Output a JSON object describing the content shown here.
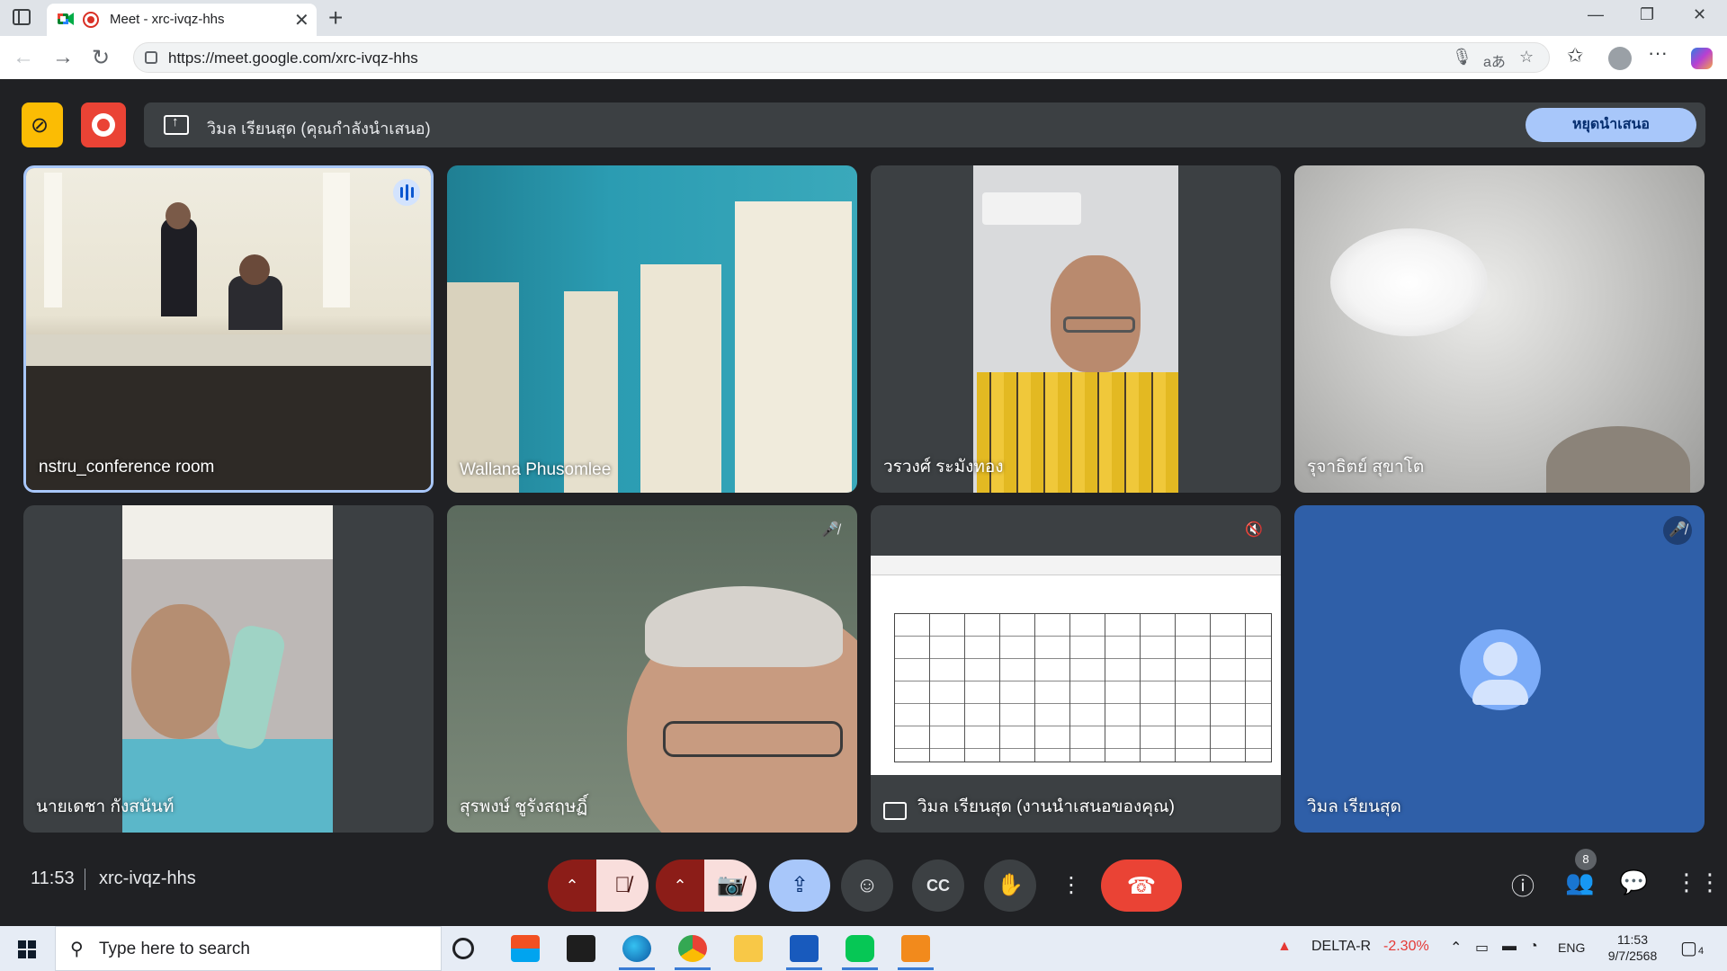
{
  "browser": {
    "tab_title": "Meet - xrc-ivqz-hhs",
    "tab_close": "✕",
    "new_tab": "+",
    "url": "https://meet.google.com/xrc-ivqz-hhs",
    "minimize": "—",
    "restore": "❐",
    "close": "✕"
  },
  "presenting": {
    "banner_text": "วิมล เรียนสุด (คุณกำลังนำเสนอ)",
    "stop_button": "หยุดนำเสนอ"
  },
  "tiles": [
    {
      "name": "nstru_conference room",
      "speaking": true,
      "muted": false
    },
    {
      "name": "Wallana Phusomlee",
      "speaking": false,
      "muted": false
    },
    {
      "name": "วรวงศ์ ระมังทอง",
      "speaking": false,
      "muted": false
    },
    {
      "name": "รุจาธิตย์ สุขาโต",
      "speaking": false,
      "muted": false
    },
    {
      "name": "นายเดชา กังสนันท์",
      "speaking": false,
      "muted": false
    },
    {
      "name": "สุรพงษ์ ชูรังสฤษฏิ์",
      "speaking": false,
      "muted": true
    },
    {
      "name": "วิมล เรียนสุด (งานนำเสนอของคุณ)",
      "speaking": false,
      "muted": true
    },
    {
      "name": "วิมล เรียนสุด",
      "speaking": false,
      "muted": true
    }
  ],
  "controls": {
    "time": "11:53",
    "meeting_code": "xrc-ivqz-hhs",
    "participant_count": "8"
  },
  "taskbar": {
    "search_placeholder": "Type here to search",
    "stock_name": "DELTA-R",
    "stock_change": "-2.30%",
    "language": "ENG",
    "time": "11:53",
    "date": "9/7/2568",
    "notification_count": "4"
  },
  "colors": {
    "meet_bg": "#202124",
    "tile_bg": "#3c4043",
    "leave_red": "#ea4335",
    "present_blue": "#a8c7fa",
    "rec_yellow": "#fbbc04"
  },
  "icons": [
    "meet-favicon",
    "recording-icon",
    "lock-icon",
    "mic-icon",
    "translate-icon",
    "star-icon",
    "favorites-icon",
    "profile-icon",
    "more-icon",
    "copilot-icon",
    "no-recording-icon",
    "present-icon",
    "mic-off-icon",
    "camera-off-icon",
    "present-screen-icon",
    "emoji-icon",
    "captions-icon",
    "raise-hand-icon",
    "leave-call-icon",
    "info-icon",
    "people-icon",
    "chat-icon",
    "activities-icon",
    "speaking-icon"
  ]
}
